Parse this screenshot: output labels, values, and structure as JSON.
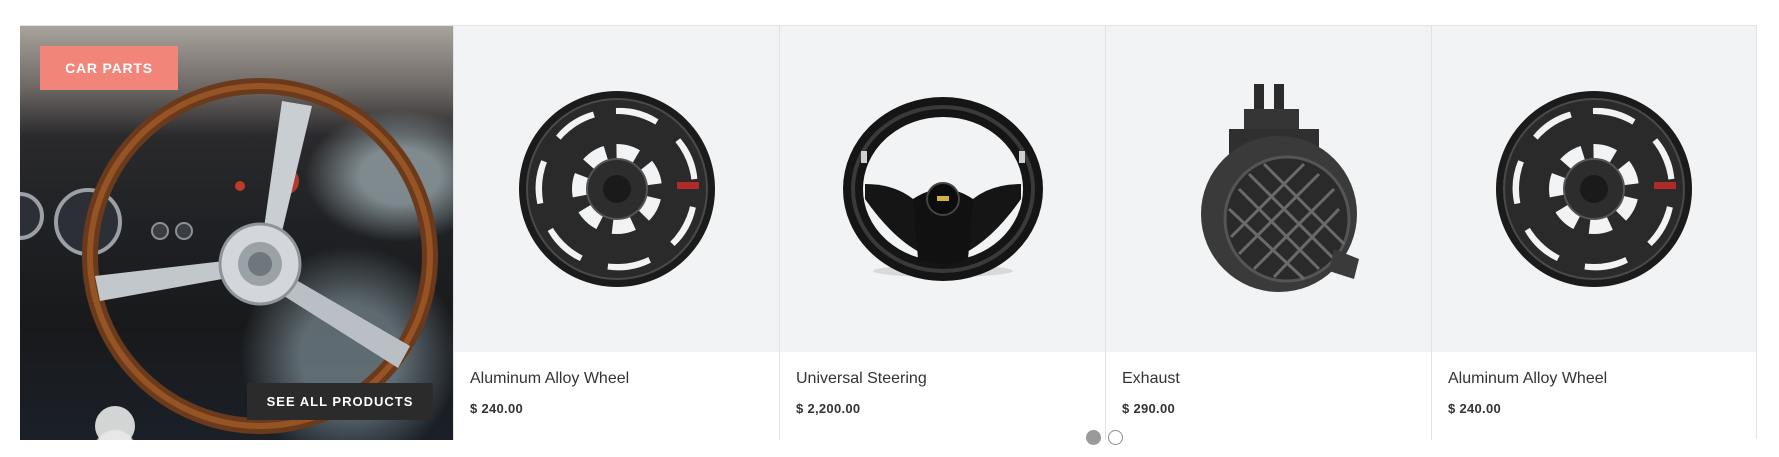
{
  "promo": {
    "badge_label": "CAR PARTS",
    "cta_label": "SEE ALL PRODUCTS"
  },
  "products": [
    {
      "name": "Aluminum Alloy Wheel",
      "price": "$ 240.00",
      "image_icon": "alloy-wheel-icon"
    },
    {
      "name": "Universal Steering",
      "price": "$ 2,200.00",
      "image_icon": "steering-wheel-icon"
    },
    {
      "name": "Exhaust",
      "price": "$ 290.00",
      "image_icon": "exhaust-part-icon"
    },
    {
      "name": "Aluminum Alloy Wheel",
      "price": "$ 240.00",
      "image_icon": "alloy-wheel-icon"
    }
  ],
  "carousel": {
    "pages": 2,
    "active_page": 1
  },
  "colors": {
    "badge": "#f1857a",
    "cta": "#2b2b2b",
    "card_image_bg": "#f2f3f4"
  }
}
